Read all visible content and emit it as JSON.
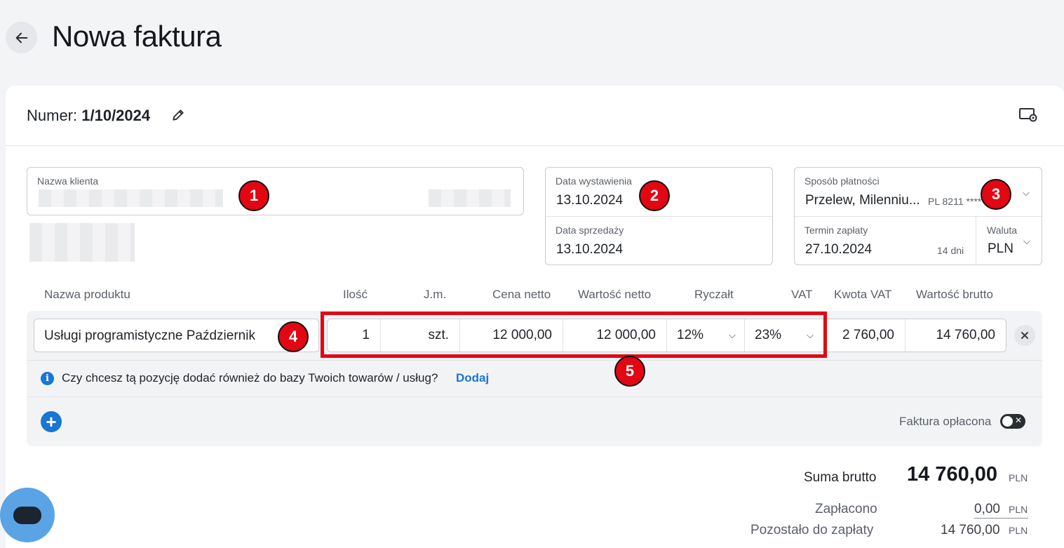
{
  "header": {
    "title": "Nowa faktura",
    "back_icon": "arrow-left-icon"
  },
  "invoice": {
    "number_label": "Numer:",
    "number_value": "1/10/2024"
  },
  "client": {
    "label": "Nazwa klienta",
    "value": ""
  },
  "dates": {
    "issue_label": "Data wystawienia",
    "issue_value": "13.10.2024",
    "sale_label": "Data sprzedaży",
    "sale_value": "13.10.2024"
  },
  "payment": {
    "method_label": "Sposób płatności",
    "method_value": "Przelew, Milenniu...",
    "method_account": "PL 8211 ****",
    "due_label": "Termin zapłaty",
    "due_value": "27.10.2024",
    "due_days": "14 dni",
    "currency_label": "Waluta",
    "currency_value": "PLN"
  },
  "columns": {
    "product": "Nazwa produktu",
    "qty": "Ilość",
    "unit": "J.m.",
    "net_price": "Cena netto",
    "net_value": "Wartość netto",
    "lump": "Ryczałt",
    "vat": "VAT",
    "vat_amount": "Kwota VAT",
    "gross_value": "Wartość brutto"
  },
  "item": {
    "product": "Usługi programistyczne Październik",
    "qty": "1",
    "unit": "szt.",
    "net_price": "12 000,00",
    "net_value": "12 000,00",
    "lump": "12%",
    "vat": "23%",
    "vat_amount": "2 760,00",
    "gross_value": "14 760,00"
  },
  "hint": {
    "text": "Czy chcesz tą pozycję dodać również do bazy Twoich towarów / usług?",
    "link": "Dodaj"
  },
  "paid_toggle": {
    "label": "Faktura opłacona",
    "on": false
  },
  "totals": {
    "gross_label": "Suma brutto",
    "gross_value": "14 760,00",
    "currency": "PLN",
    "paid_label": "Zapłacono",
    "paid_value": "0,00",
    "remaining_label": "Pozostało do zapłaty",
    "remaining_value": "14 760,00"
  },
  "annotations": [
    "1",
    "2",
    "3",
    "4",
    "5"
  ],
  "colors": {
    "accent": "#1976d2",
    "annotation": "#e30613",
    "chat": "#5aa4e6"
  }
}
